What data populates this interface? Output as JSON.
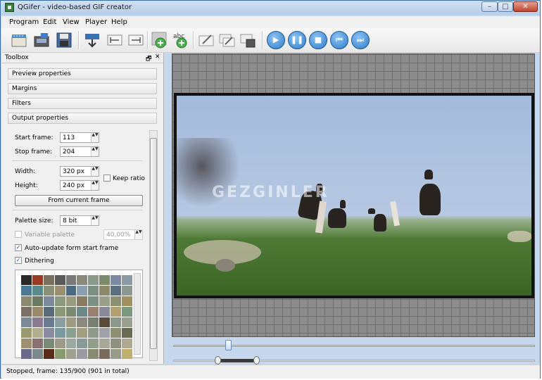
{
  "window": {
    "title": "QGifer - video-based GIF creator",
    "controls": {
      "minimize": "–",
      "maximize": "□",
      "close": "✕"
    }
  },
  "menu": [
    "Program",
    "Edit",
    "View",
    "Player",
    "Help"
  ],
  "toolbar": {
    "icons": [
      "open-video-icon",
      "extract-gif-icon",
      "save-gif-icon",
      "frame-icon",
      "set-start-icon",
      "set-end-icon",
      "add-object-icon",
      "add-text-icon",
      "edit-object-icon",
      "edit-all-icon",
      "remove-object-icon"
    ],
    "player": {
      "play": "▶",
      "pause": "❚❚",
      "stop": "■",
      "prev": "⏮",
      "next": "⏭"
    }
  },
  "toolbox": {
    "title": "Toolbox",
    "dock_float": "🗗",
    "dock_close": "✕",
    "sections": [
      "Preview properties",
      "Margins",
      "Filters",
      "Output properties"
    ],
    "start_frame_label": "Start frame:",
    "start_frame_value": "113",
    "stop_frame_label": "Stop frame:",
    "stop_frame_value": "204",
    "width_label": "Width:",
    "width_value": "320 px",
    "height_label": "Height:",
    "height_value": "240 px",
    "keep_ratio_label": "Keep ratio",
    "from_current_frame_label": "From current frame",
    "palette_size_label": "Palette size:",
    "palette_size_value": "8 bit",
    "variable_palette_label": "Variable palette",
    "variable_palette_value": "40,00%",
    "auto_update_label": "Auto-update form start frame",
    "dithering_label": "Dithering",
    "check_mark": "✓",
    "spin_arrows": "▲▼",
    "palette_colors": [
      "#2c2a28",
      "#9a3a22",
      "#7a7060",
      "#5a5a5a",
      "#7a7a7a",
      "#8a8a7a",
      "#8a9a8a",
      "#7a8a6a",
      "#7a8aa0",
      "#8a9aa4",
      "#4a7a94",
      "#5a8a8a",
      "#8a9078",
      "#9a9070",
      "#4a6a84",
      "#8aa0b0",
      "#7a9080",
      "#8a8a6a",
      "#5a7080",
      "#8a9890",
      "#8a8a70",
      "#6a7a60",
      "#7a8a9a",
      "#8a9a80",
      "#9a9a80",
      "#8a7a60",
      "#7a9080",
      "#9aa088",
      "#8a9070",
      "#a09060",
      "#7a7068",
      "#9a8a6a",
      "#5a6a78",
      "#8a9a78",
      "#7a8a70",
      "#6a8a8a",
      "#9a8070",
      "#8a8a9a",
      "#b0a070",
      "#7a9a80",
      "#7a8a98",
      "#8a7a90",
      "#6a7a90",
      "#8aa0a0",
      "#a09a80",
      "#8a8a80",
      "#7a8070",
      "#5a4a3a",
      "#8a9a8a",
      "#9aa090",
      "#9a9a70",
      "#b0b090",
      "#8a8aa0",
      "#7a9aa0",
      "#8aa090",
      "#a0a080",
      "#909a8a",
      "#a0a0a8",
      "#8a9070",
      "#6a6a50",
      "#a09070",
      "#8a7070",
      "#7a8a78",
      "#a09888",
      "#9aa8a0",
      "#8a9a98",
      "#90a088",
      "#a8a898",
      "#909080",
      "#b0a890",
      "#6a6a8a",
      "#7a8a8a",
      "#5a2a1a",
      "#8a9a70",
      "#a0a090",
      "#9a9aa0",
      "#8a8a70",
      "#7a6a5a",
      "#9a9a88",
      "#c0b070"
    ]
  },
  "preview": {
    "watermark": "GEZGINLER"
  },
  "status": "Stopped, frame: 135/900 (901 in total)"
}
